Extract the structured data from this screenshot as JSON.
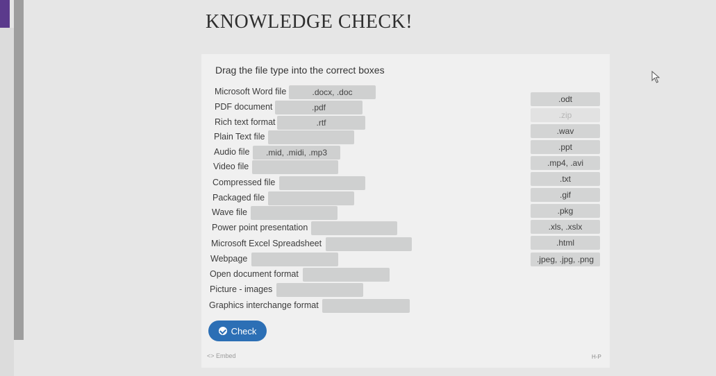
{
  "title": "KNOWLEDGE CHECK!",
  "instruction": "Drag the file type into the correct boxes",
  "rows": [
    {
      "label": "Microsoft Word file",
      "answer": ".docx, .doc"
    },
    {
      "label": "PDF document",
      "answer": ".pdf"
    },
    {
      "label": "Rich text format",
      "answer": ".rtf"
    },
    {
      "label": "Plain Text file",
      "answer": ""
    },
    {
      "label": "Audio file",
      "answer": ".mid, .midi, .mp3"
    },
    {
      "label": "Video file",
      "answer": ""
    },
    {
      "label": "Compressed file",
      "answer": ""
    },
    {
      "label": "Packaged file",
      "answer": ""
    },
    {
      "label": "Wave file",
      "answer": ""
    },
    {
      "label": "Power point presentation",
      "answer": ""
    },
    {
      "label": "Microsoft Excel Spreadsheet",
      "answer": ""
    },
    {
      "label": "Webpage",
      "answer": ""
    },
    {
      "label": "Open document format",
      "answer": ""
    },
    {
      "label": "Picture - images",
      "answer": ""
    },
    {
      "label": "Graphics interchange format",
      "answer": ""
    }
  ],
  "chips": [
    {
      "label": ".odt",
      "used": false
    },
    {
      "label": ".zip",
      "used": true
    },
    {
      "label": ".wav",
      "used": false
    },
    {
      "label": ".ppt",
      "used": false
    },
    {
      "label": ".mp4, .avi",
      "used": false
    },
    {
      "label": ".txt",
      "used": false
    },
    {
      "label": ".gif",
      "used": false
    },
    {
      "label": ".pkg",
      "used": false
    },
    {
      "label": ".xls, .xslx",
      "used": false
    },
    {
      "label": ".html",
      "used": false
    },
    {
      "label": ".jpeg, .jpg, .png",
      "used": false
    }
  ],
  "check_button": "Check",
  "embed_label": "<> Embed",
  "footer_mark": "H-P"
}
